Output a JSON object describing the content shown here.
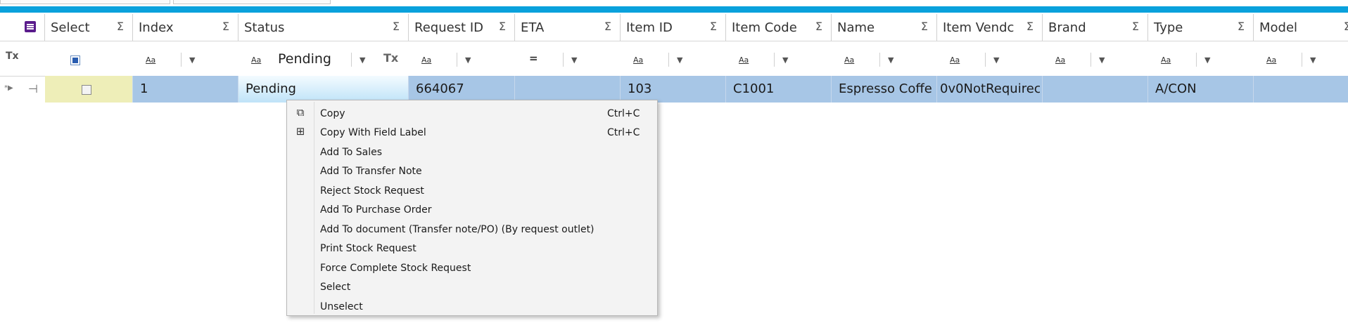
{
  "columns": [
    {
      "key": "select",
      "label": "Select"
    },
    {
      "key": "index",
      "label": "Index"
    },
    {
      "key": "status",
      "label": "Status"
    },
    {
      "key": "request_id",
      "label": "Request ID"
    },
    {
      "key": "eta",
      "label": "ETA"
    },
    {
      "key": "item_id",
      "label": "Item ID"
    },
    {
      "key": "item_code",
      "label": "Item Code"
    },
    {
      "key": "name",
      "label": "Name"
    },
    {
      "key": "item_vendor",
      "label": "Item Vendc"
    },
    {
      "key": "brand",
      "label": "Brand"
    },
    {
      "key": "type",
      "label": "Type"
    },
    {
      "key": "model",
      "label": "Model"
    }
  ],
  "sum_symbol": "Σ",
  "filter": {
    "text_op": "Aa",
    "eq_op": "=",
    "status_value": "Pending",
    "clear_symbol": "Tx"
  },
  "row": {
    "index": "1",
    "status": "Pending",
    "request_id": "664067",
    "eta": "",
    "item_id": "103",
    "item_code": "C1001",
    "name": "Espresso Coffe",
    "item_vendor": "0v0NotRequirec",
    "brand": "",
    "type": "A/CON",
    "model": ""
  },
  "context_menu": [
    {
      "label": "Copy",
      "shortcut": "Ctrl+C",
      "icon": "copy-icon"
    },
    {
      "label": "Copy With Field Label",
      "shortcut": "Ctrl+C",
      "icon": "copy-with-label-icon"
    },
    {
      "label": "Add To Sales",
      "shortcut": ""
    },
    {
      "label": "Add To Transfer Note",
      "shortcut": ""
    },
    {
      "label": "Reject Stock Request",
      "shortcut": ""
    },
    {
      "label": "Add To Purchase Order",
      "shortcut": ""
    },
    {
      "label": "Add To document (Transfer note/PO) (By request outlet)",
      "shortcut": ""
    },
    {
      "label": "Print Stock Request",
      "shortcut": ""
    },
    {
      "label": "Force Complete Stock Request",
      "shortcut": ""
    },
    {
      "label": "Select",
      "shortcut": ""
    },
    {
      "label": "Unselect",
      "shortcut": ""
    }
  ],
  "colors": {
    "accent": "#0aa1dc",
    "row_selected": "#a7c6e6",
    "select_cell": "#eeeeb8"
  }
}
